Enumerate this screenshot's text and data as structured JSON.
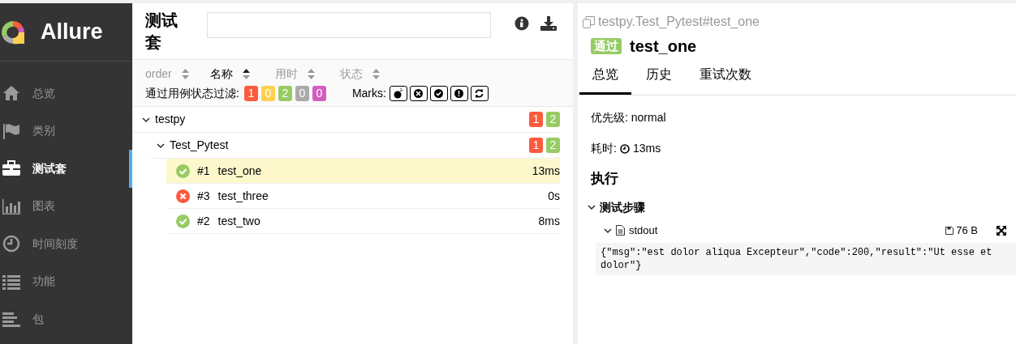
{
  "sidebar": {
    "logo": "Allure",
    "items": [
      {
        "label": "总览",
        "selected": false
      },
      {
        "label": "类别",
        "selected": false
      },
      {
        "label": "测试套",
        "selected": true
      },
      {
        "label": "图表",
        "selected": false
      },
      {
        "label": "时间刻度",
        "selected": false
      },
      {
        "label": "功能",
        "selected": false
      },
      {
        "label": "包",
        "selected": false
      }
    ]
  },
  "suites": {
    "title": "测试套",
    "sort_columns": [
      {
        "label": "order",
        "selected": false
      },
      {
        "label": "名称",
        "selected": true
      },
      {
        "label": "用时",
        "selected": false
      },
      {
        "label": "状态",
        "selected": false
      }
    ],
    "filter_label": "通过用例状态过滤:",
    "status_filters": [
      {
        "count": "1",
        "color": "#fd5a3e"
      },
      {
        "count": "0",
        "color": "#ffd050"
      },
      {
        "count": "2",
        "color": "#97cc64"
      },
      {
        "count": "0",
        "color": "#aaaaaa"
      },
      {
        "count": "0",
        "color": "#d35ebe"
      }
    ],
    "marks_label": "Marks:",
    "tree": [
      {
        "name": "testpy",
        "expanded": true,
        "counts": [
          {
            "count": "1",
            "color": "#fd5a3e"
          },
          {
            "count": "2",
            "color": "#97cc64"
          }
        ],
        "children": [
          {
            "name": "Test_Pytest",
            "expanded": true,
            "counts": [
              {
                "count": "1",
                "color": "#fd5a3e"
              },
              {
                "count": "2",
                "color": "#97cc64"
              }
            ],
            "tests": [
              {
                "kind": "passed",
                "number": "#1",
                "name": "test_one",
                "duration": "13ms",
                "selected": true
              },
              {
                "kind": "failed",
                "number": "#3",
                "name": "test_three",
                "duration": "0s",
                "selected": false
              },
              {
                "kind": "passed",
                "number": "#2",
                "name": "test_two",
                "duration": "8ms",
                "selected": false
              }
            ]
          }
        ]
      }
    ]
  },
  "detail": {
    "path": "testpy.Test_Pytest#test_one",
    "status_badge": "通过",
    "title": "test_one",
    "tabs": [
      {
        "label": "总览",
        "selected": true
      },
      {
        "label": "历史",
        "selected": false
      },
      {
        "label": "重试次数",
        "selected": false
      }
    ],
    "priority": "优先级: normal",
    "duration_label": "耗时:",
    "duration": "13ms",
    "section": "执行",
    "steps": {
      "title": "测试步骤",
      "expanded": true,
      "attachment": {
        "name": "stdout",
        "expanded": true,
        "size": "76 B",
        "content": "{\"msg\":\"est dolor aliqua Excepteur\",\"code\":200,\"result\":\"Ut esse et dolor\"}"
      }
    }
  }
}
